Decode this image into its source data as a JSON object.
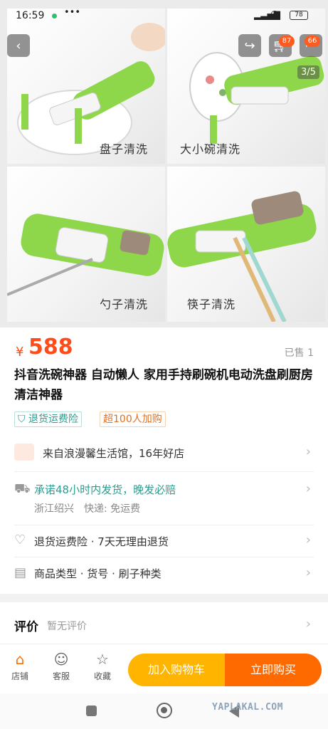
{
  "status_bar": {
    "time": "16:59",
    "more": "•••",
    "battery": "78"
  },
  "hero": {
    "pager": "3/5",
    "cart_badge": "87",
    "more_badge": "66",
    "captions": [
      "盘子清洗",
      "大小碗清洗",
      "勺子清洗",
      "筷子清洗"
    ],
    "colors": {
      "device_green": "#8ed64a",
      "accent_orange": "#ff5a1f"
    }
  },
  "product": {
    "currency": "¥",
    "price": "588",
    "sold": "已售 1",
    "title": "抖音洗碗神器 自动懒人 家用手持刷碗机电动洗盘刷厨房清洁神器",
    "tags": [
      "退货运费险",
      "超100人加购"
    ]
  },
  "shop": {
    "label": "来自浪漫馨生活馆，16年好店"
  },
  "shipping": {
    "promise": "承诺48小时内发货，晚发必赔",
    "location": "浙江绍兴",
    "delivery": "快递: 免运费"
  },
  "guarantee": {
    "label": "退货运费险 · 7天无理由退货"
  },
  "params": {
    "label": "商品类型 · 货号 · 刷子种类"
  },
  "reviews": {
    "title": "评价",
    "subtitle": "暂无评价"
  },
  "bottom_bar": {
    "shop": "店铺",
    "service": "客服",
    "favorite": "收藏",
    "add_to_cart": "加入购物车",
    "buy_now": "立即购买"
  },
  "watermark": "YAPLAKAL.COM"
}
